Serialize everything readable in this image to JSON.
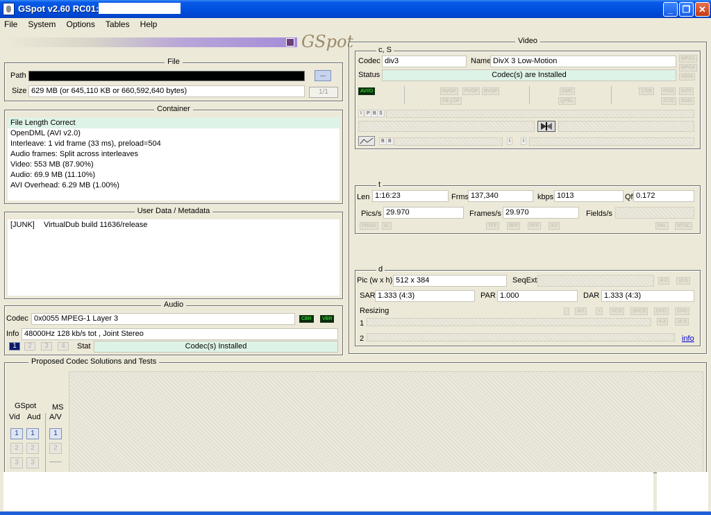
{
  "window": {
    "title": "GSpot v2.60 RC01:",
    "buttons": {
      "minimize": "_",
      "maximize": "❐",
      "close": "✕"
    }
  },
  "menu": [
    "File",
    "System",
    "Options",
    "Tables",
    "Help"
  ],
  "logo": "GSpot",
  "file": {
    "title": "File",
    "path_label": "Path",
    "path_value": "",
    "browse_label": "...",
    "size_label": "Size",
    "size_value": "629 MB (or 645,110 KB or 660,592,640 bytes)",
    "part_label": "1/1"
  },
  "container": {
    "title": "Container",
    "lines": [
      "File Length Correct",
      "OpenDML (AVI v2.0)",
      "Interleave: 1 vid frame (33 ms), preload=504",
      "Audio frames: Split across interleaves",
      "Video: 553 MB (87.90%)",
      "Audio: 69.9 MB (11.10%)",
      "AVI Overhead: 6.29 MB (1.00%)"
    ]
  },
  "userdata": {
    "title": "User Data / Metadata",
    "tag": "[JUNK]",
    "value": "VirtualDub build 11636/release"
  },
  "audio": {
    "title": "Audio",
    "codec_label": "Codec",
    "codec_value": "0x0055 MPEG-1 Layer 3",
    "cbr": "CBR",
    "vbr": "VBR",
    "info_label": "Info",
    "info_value": "48000Hz  128 kb/s tot , Joint Stereo",
    "stream_buttons": [
      "1",
      "2",
      "3",
      "4"
    ],
    "stat_label": "Stat",
    "stat_value": "Codec(s) Installed"
  },
  "video": {
    "title": "Video",
    "cs_title": "c, S",
    "codec_label": "Codec",
    "codec_value": "div3",
    "name_label": "Name",
    "name_value": "DivX 3 Low-Motion",
    "status_label": "Status",
    "status_value": "Codec(s) are Installed",
    "side_chips": [
      "MPG2",
      "MPG4",
      "H264"
    ],
    "avi_chip": "AVI/O",
    "mid_chips": [
      "NVOP",
      "PVOP",
      "BVOP",
      "FB",
      "DF",
      "GMC",
      "QPEL",
      "1709",
      "FOO",
      "IH70",
      "2170",
      "5240"
    ],
    "frame_chips": [
      "I",
      "P",
      "B",
      "S"
    ],
    "t_title": "t",
    "len_label": "Len",
    "len_value": "1:16:23",
    "frms_label": "Frms",
    "frms_value": "137,340",
    "kbps_label": "kbps",
    "kbps_value": "1013",
    "qf_label": "Qf",
    "qf_value": "0.172",
    "pics_label": "Pics/s",
    "pics_value": "29.970",
    "frames_label": "Frames/s",
    "frames_value": "29.970",
    "fields_label": "Fields/s",
    "fields_value": "",
    "scan_chips": [
      "PROG",
      "I/L",
      "TFF",
      "BFF",
      "PFF",
      "3:2",
      "PAL",
      "NTSC"
    ],
    "d_title": "d",
    "pic_label": "Pic (w x h)",
    "pic_value": "512 x 384",
    "seqext_label": "SeqExt",
    "aspect_chips": [
      "4:3",
      "16:9"
    ],
    "sar_label": "SAR",
    "sar_value": "1.333 (4:3)",
    "par_label": "PAR",
    "par_value": "1.000",
    "dar_label": "DAR",
    "dar_value": "1.333 (4:3)",
    "resizing_label": "Resizing",
    "resize_chips": [
      "AVI",
      "VCD",
      "SVCD",
      "DVD",
      "DVD"
    ],
    "row1_label": "1",
    "row2_label": "2",
    "info_link": "info"
  },
  "proposed": {
    "title": "Proposed Codec Solutions and Tests",
    "gspot_label": "GSpot",
    "vid_label": "Vid",
    "aud_label": "Aud",
    "ms_label": "MS",
    "av_label": "A/V",
    "buttons": [
      "1",
      "2",
      "3"
    ]
  }
}
